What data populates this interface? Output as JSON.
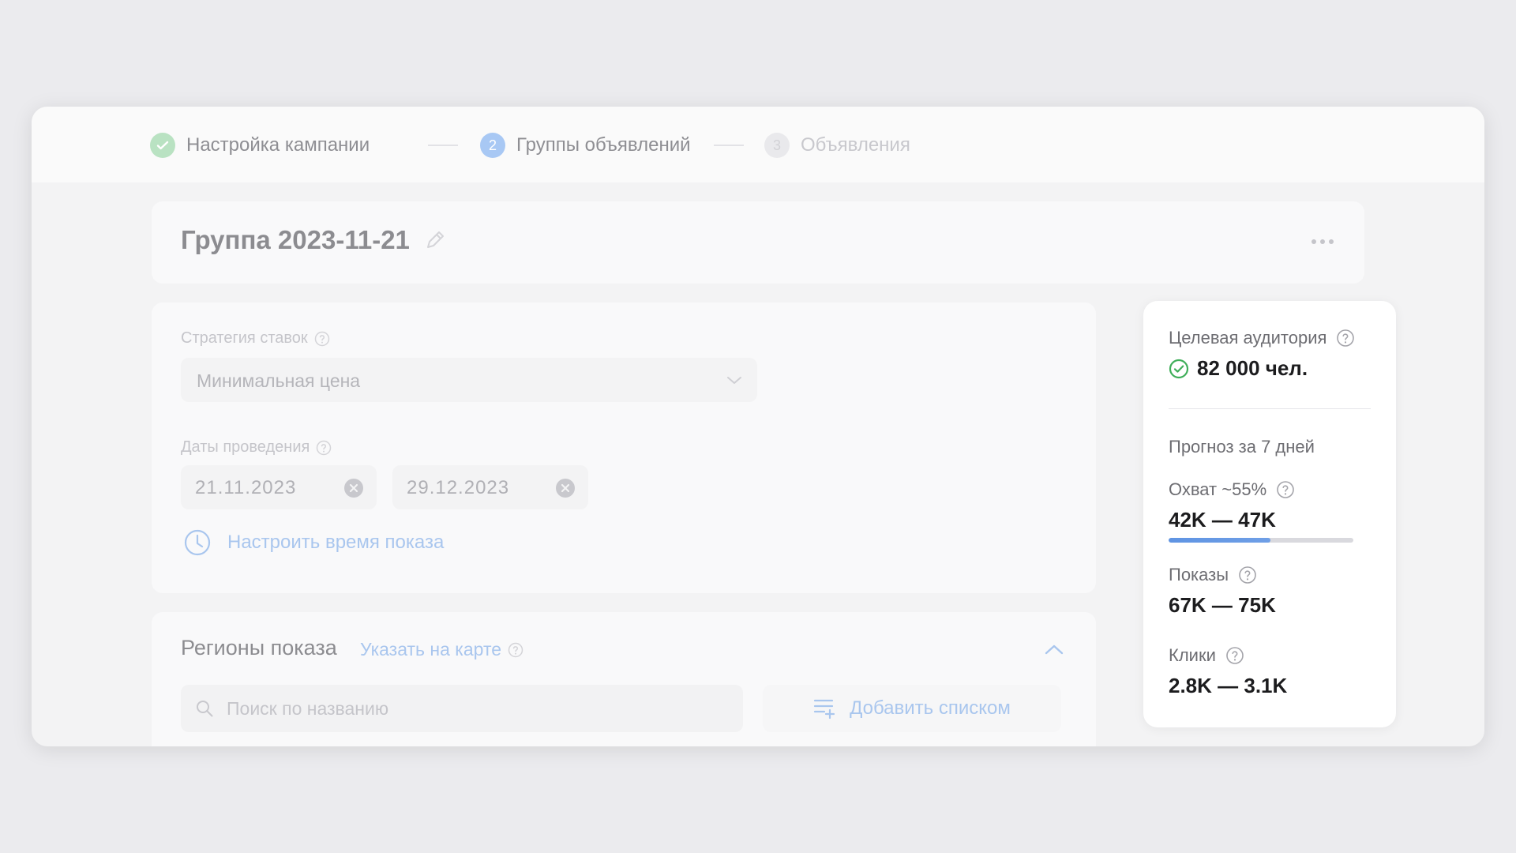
{
  "stepper": {
    "steps": [
      {
        "label": "Настройка кампании",
        "state": "done",
        "number": ""
      },
      {
        "label": "Группы объявлений",
        "state": "active",
        "number": "2"
      },
      {
        "label": "Объявления",
        "state": "todo",
        "number": "3"
      }
    ]
  },
  "group": {
    "title": "Группа 2023-11-21"
  },
  "strategy": {
    "label": "Стратегия ставок",
    "value": "Минимальная цена"
  },
  "dates": {
    "label": "Даты проведения",
    "start": "21.11.2023",
    "end": "29.12.2023"
  },
  "schedule": {
    "link_label": "Настроить время показа"
  },
  "regions": {
    "title": "Регионы показа",
    "map_link": "Указать на карте",
    "search_placeholder": "Поиск по названию",
    "add_list_label": "Добавить списком"
  },
  "forecast": {
    "audience_label": "Целевая аудитория",
    "audience_value": "82 000 чел.",
    "period_label": "Прогноз за 7 дней",
    "reach_label": "Охват ~55%",
    "reach_value": "42K — 47K",
    "reach_fraction": 0.55,
    "impressions_label": "Показы",
    "impressions_value": "67K — 75K",
    "clicks_label": "Клики",
    "clicks_value": "2.8K — 3.1K"
  },
  "colors": {
    "accent": "#5f94e3",
    "success": "#3fae59",
    "link": "#a9c6ee"
  }
}
